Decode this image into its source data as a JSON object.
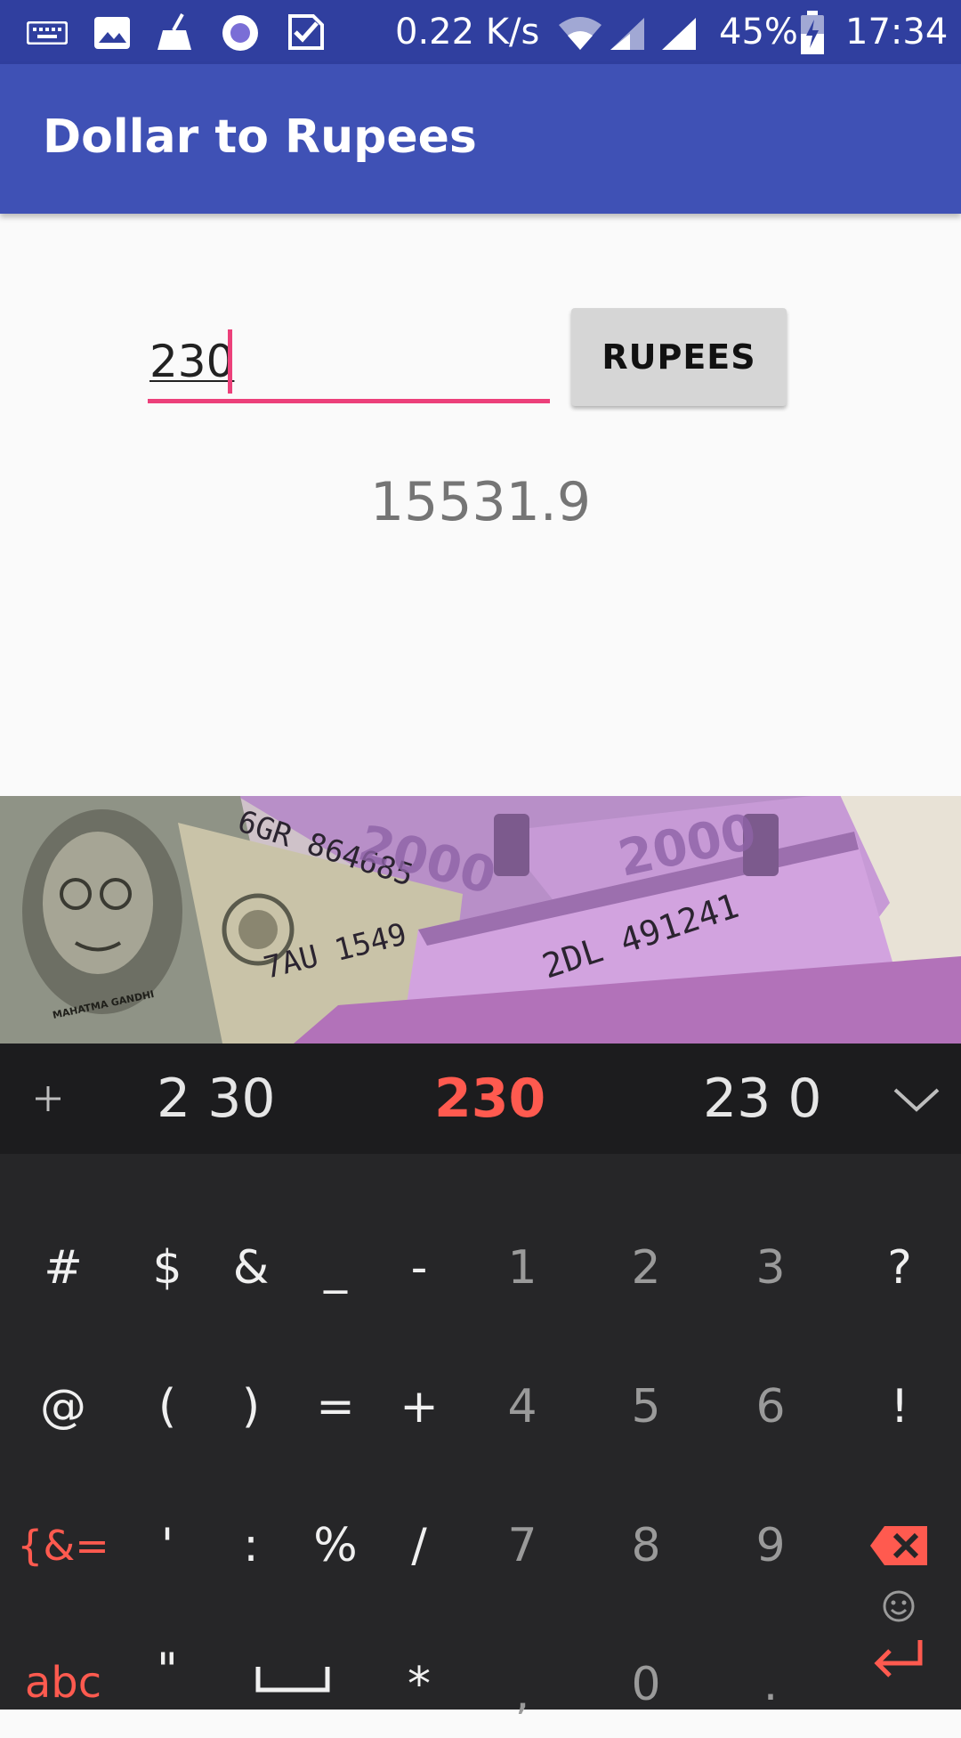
{
  "status_bar": {
    "net_speed": "0.22 K/s",
    "battery": "45%",
    "time": "17:34",
    "icons": [
      "keyboard-icon",
      "image-icon",
      "broom-icon",
      "circle-icon",
      "check-icon",
      "wifi-icon",
      "signal-icon",
      "signal-icon",
      "battery-charging-icon"
    ]
  },
  "app_bar": {
    "title": "Dollar to Rupees"
  },
  "form": {
    "amount_value": "230",
    "button_label": "RUPEES",
    "result": "15531.9"
  },
  "banner": {
    "note_text": [
      "6GR 864685",
      "2000",
      "7AU 1549",
      "2DL 491241",
      "MAHATMA GANDHI"
    ]
  },
  "keyboard": {
    "suggestions": {
      "add_icon": "plus-icon",
      "left": "2 30",
      "center": "230",
      "right": "23 0",
      "collapse_icon": "chevron-down-icon"
    },
    "rows": [
      [
        "#",
        "$",
        "&",
        "_",
        "-",
        "1",
        "2",
        "3",
        "?"
      ],
      [
        "@",
        "(",
        ")",
        "=",
        "+",
        "4",
        "5",
        "6",
        "!"
      ],
      [
        "{&=",
        "'",
        ":",
        "%",
        "/",
        "7",
        "8",
        "9"
      ],
      [
        "abc",
        "\"",
        "*",
        ",",
        "0",
        "."
      ]
    ],
    "colors": {
      "accent": "#ff5a4f",
      "background": "#262628"
    }
  },
  "colors": {
    "primary": "#3f51b5",
    "primary_dark": "#303f9f",
    "accent": "#ec407a"
  }
}
